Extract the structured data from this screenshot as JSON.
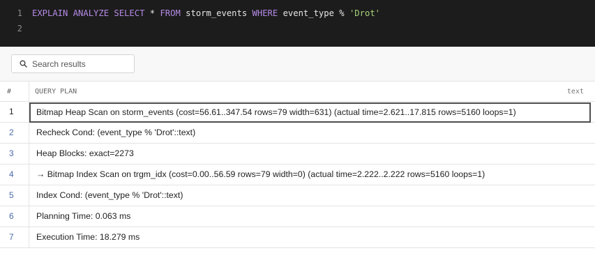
{
  "editor": {
    "lines": [
      {
        "number": "1",
        "tokens": [
          {
            "t": "EXPLAIN ANALYZE SELECT",
            "k": "kw"
          },
          {
            "t": " * ",
            "k": "op"
          },
          {
            "t": "FROM",
            "k": "kw"
          },
          {
            "t": " storm_events ",
            "k": "plain"
          },
          {
            "t": "WHERE",
            "k": "kw"
          },
          {
            "t": " event_type % ",
            "k": "plain"
          },
          {
            "t": "'Drot'",
            "k": "str"
          }
        ]
      },
      {
        "number": "2",
        "tokens": []
      }
    ]
  },
  "results": {
    "search_placeholder": "Search results",
    "columns": {
      "num": "#",
      "plan": "QUERY PLAN",
      "type": "text"
    },
    "rows": [
      {
        "n": "1",
        "v": "Bitmap Heap Scan on storm_events (cost=56.61..347.54 rows=79 width=631) (actual time=2.621..17.815 rows=5160 loops=1)"
      },
      {
        "n": "2",
        "v": "Recheck Cond: (event_type % 'Drot'::text)"
      },
      {
        "n": "3",
        "v": "Heap Blocks: exact=2273"
      },
      {
        "n": "4",
        "v": "→ Bitmap Index Scan on trgm_idx (cost=0.00..56.59 rows=79 width=0) (actual time=2.222..2.222 rows=5160 loops=1)"
      },
      {
        "n": "5",
        "v": "Index Cond: (event_type % 'Drot'::text)"
      },
      {
        "n": "6",
        "v": "Planning Time: 0.063 ms"
      },
      {
        "n": "7",
        "v": "Execution Time: 18.279 ms"
      }
    ],
    "selected_row": 0
  },
  "colors": {
    "editor_bg": "#1c1c1c",
    "keyword": "#b48ae6",
    "string": "#a7d47c",
    "row_number": "#4a6aa8"
  },
  "icons": {
    "search": "search-icon"
  }
}
